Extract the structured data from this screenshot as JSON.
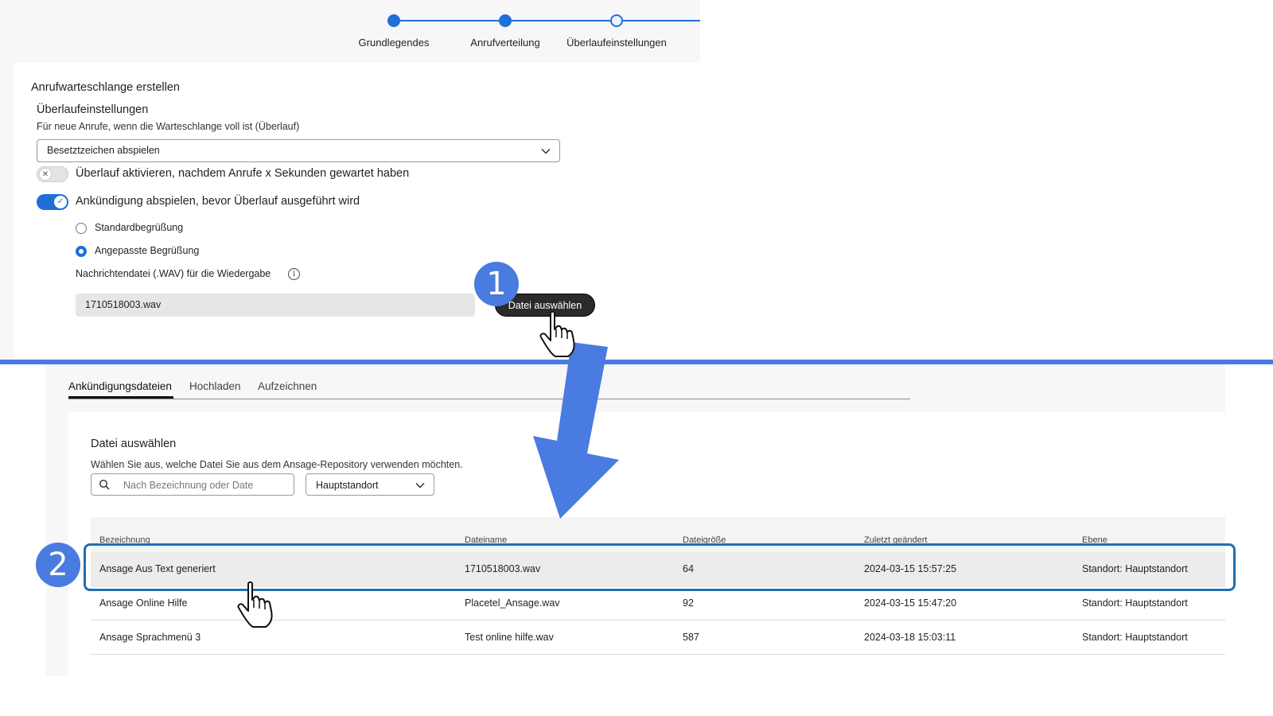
{
  "stepper": {
    "steps": [
      {
        "label": "Grundlegendes",
        "state": "done"
      },
      {
        "label": "Anrufverteilung",
        "state": "done"
      },
      {
        "label": "Überlaufeinstellungen",
        "state": "current"
      }
    ]
  },
  "form": {
    "title": "Anrufwarteschlange erstellen",
    "section_title": "Überlaufeinstellungen",
    "section_subtitle": "Für neue Anrufe, wenn die Warteschlange voll ist (Überlauf)",
    "overflow_select": "Besetztzeichen abspielen",
    "toggle_overflow_wait": {
      "label": "Überlauf aktivieren, nachdem Anrufe x Sekunden gewartet haben",
      "on": false
    },
    "toggle_announcement": {
      "label": "Ankündigung abspielen, bevor Überlauf ausgeführt wird",
      "on": true
    },
    "radio_default": {
      "label": "Standardbegrüßung",
      "checked": false
    },
    "radio_custom": {
      "label": "Angepasste Begrüßung",
      "checked": true
    },
    "file_label": "Nachrichtendatei (.WAV) für die Wiedergabe",
    "file_value": "1710518003.wav",
    "choose_button": "Datei auswählen"
  },
  "badges": {
    "one": "1",
    "two": "2"
  },
  "dialog": {
    "tabs": [
      {
        "label": "Ankündigungsdateien",
        "active": true
      },
      {
        "label": "Hochladen",
        "active": false
      },
      {
        "label": "Aufzeichnen",
        "active": false
      }
    ],
    "title": "Datei auswählen",
    "subtitle": "Wählen Sie aus, welche Datei Sie aus dem Ansage-Repository verwenden möchten.",
    "search_placeholder": "Nach Bezeichnung oder Date",
    "location_select": "Hauptstandort",
    "table": {
      "headers": [
        "Bezeichnung",
        "Dateiname",
        "Dateigröße",
        "Zuletzt geändert",
        "Ebene"
      ],
      "rows": [
        [
          "Ansage Aus Text generiert",
          "1710518003.wav",
          "64",
          "2024-03-15 15:57:25",
          "Standort: Hauptstandort"
        ],
        [
          "Ansage Online Hilfe",
          "Placetel_Ansage.wav",
          "92",
          "2024-03-15 15:47:20",
          "Standort: Hauptstandort"
        ],
        [
          "Ansage Sprachmenü 3",
          "Test online hilfe.wav",
          "587",
          "2024-03-18 15:03:11",
          "Standort: Hauptstandort"
        ]
      ],
      "selected_row": 0
    }
  },
  "colors": {
    "accent": "#1f6fd6",
    "annotation_blue": "#4a7be0",
    "highlight_border": "#1f6fb5"
  }
}
